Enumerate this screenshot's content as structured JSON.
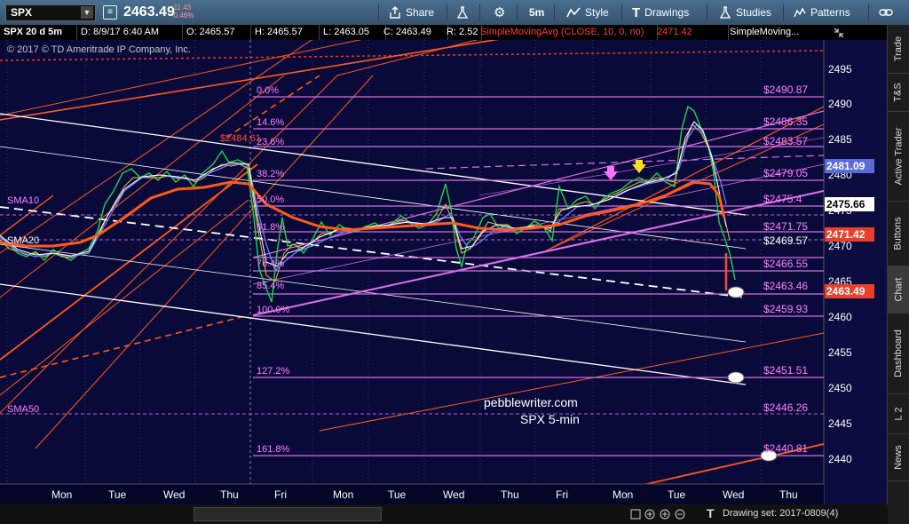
{
  "toolbar": {
    "symbol": "SPX",
    "price": "2463.49",
    "change": "-11.43",
    "change_pct": "-0.46%",
    "share": "Share",
    "timeframe": "5m",
    "style": "Style",
    "drawings": "Drawings",
    "studies": "Studies",
    "patterns": "Patterns"
  },
  "infobar": {
    "title": "SPX 20 d 5m",
    "date": "D: 8/9/17 6:40 AM",
    "open": "O: 2465.57",
    "high": "H: 2465.57",
    "low": "L: 2463.05",
    "close": "C: 2463.49",
    "range": "R: 2.52",
    "sma": "SimpleMovingAvg (CLOSE, 10, 0, no)",
    "sma_value": "2471.42",
    "sma2": "SimpleMoving..."
  },
  "copyright": "© 2017 © TD Ameritrade IP Company, Inc.",
  "watermark": {
    "line1": "pebblewriter.com",
    "line2": "SPX 5-min"
  },
  "sidebar": [
    "Trade",
    "T&S",
    "Active Trader",
    "Buttons",
    "Chart",
    "Dashboard",
    "L 2",
    "News"
  ],
  "sidebar_active": "Chart",
  "axis": {
    "price_ticks": [
      "2495",
      "2490",
      "2485",
      "2480",
      "2475",
      "2470",
      "2465",
      "2460",
      "2455",
      "2450",
      "2445",
      "2440"
    ],
    "day_labels": [
      "Mon",
      "Tue",
      "Wed",
      "Thu",
      "Fri",
      "Mon",
      "Tue",
      "Wed",
      "Thu",
      "Fri",
      "Mon",
      "Tue",
      "Wed",
      "Thu"
    ],
    "badges": [
      {
        "text": "2481.09",
        "color": "#5a6bd8"
      },
      {
        "text": "2475.66",
        "color": "#ffffff"
      },
      {
        "text": "2471.42",
        "color": "#e8402a"
      },
      {
        "text": "2463.49",
        "color": "#e8402a"
      }
    ]
  },
  "fib": {
    "percents": [
      "0.0%",
      "14.6%",
      "23.6%",
      "38.2%",
      "50.0%",
      "61.8%",
      "76.4%",
      "85.4%",
      "100.0%",
      "127.2%",
      "161.8%"
    ],
    "prices": [
      "$2490.87",
      "$2486.35",
      "$2483.57",
      "$2479.05",
      "$2475.4",
      "$2471.75",
      "$2469.57",
      "$2466.55",
      "$2463.46",
      "$2459.93",
      "$2451.51",
      "$2446.26",
      "$2440.81"
    ]
  },
  "labels": {
    "high_mark": "$2484.61",
    "sma10": "SMA10",
    "sma20": "SMA20",
    "sma50": "SMA50"
  },
  "bottom": {
    "drawing_set": "Drawing set: 2017-0809(4)"
  },
  "colors": {
    "background": "#0a0a3a",
    "fib": "#d070e0",
    "channel": "#ff5a1a",
    "sma": "#e8402a"
  }
}
